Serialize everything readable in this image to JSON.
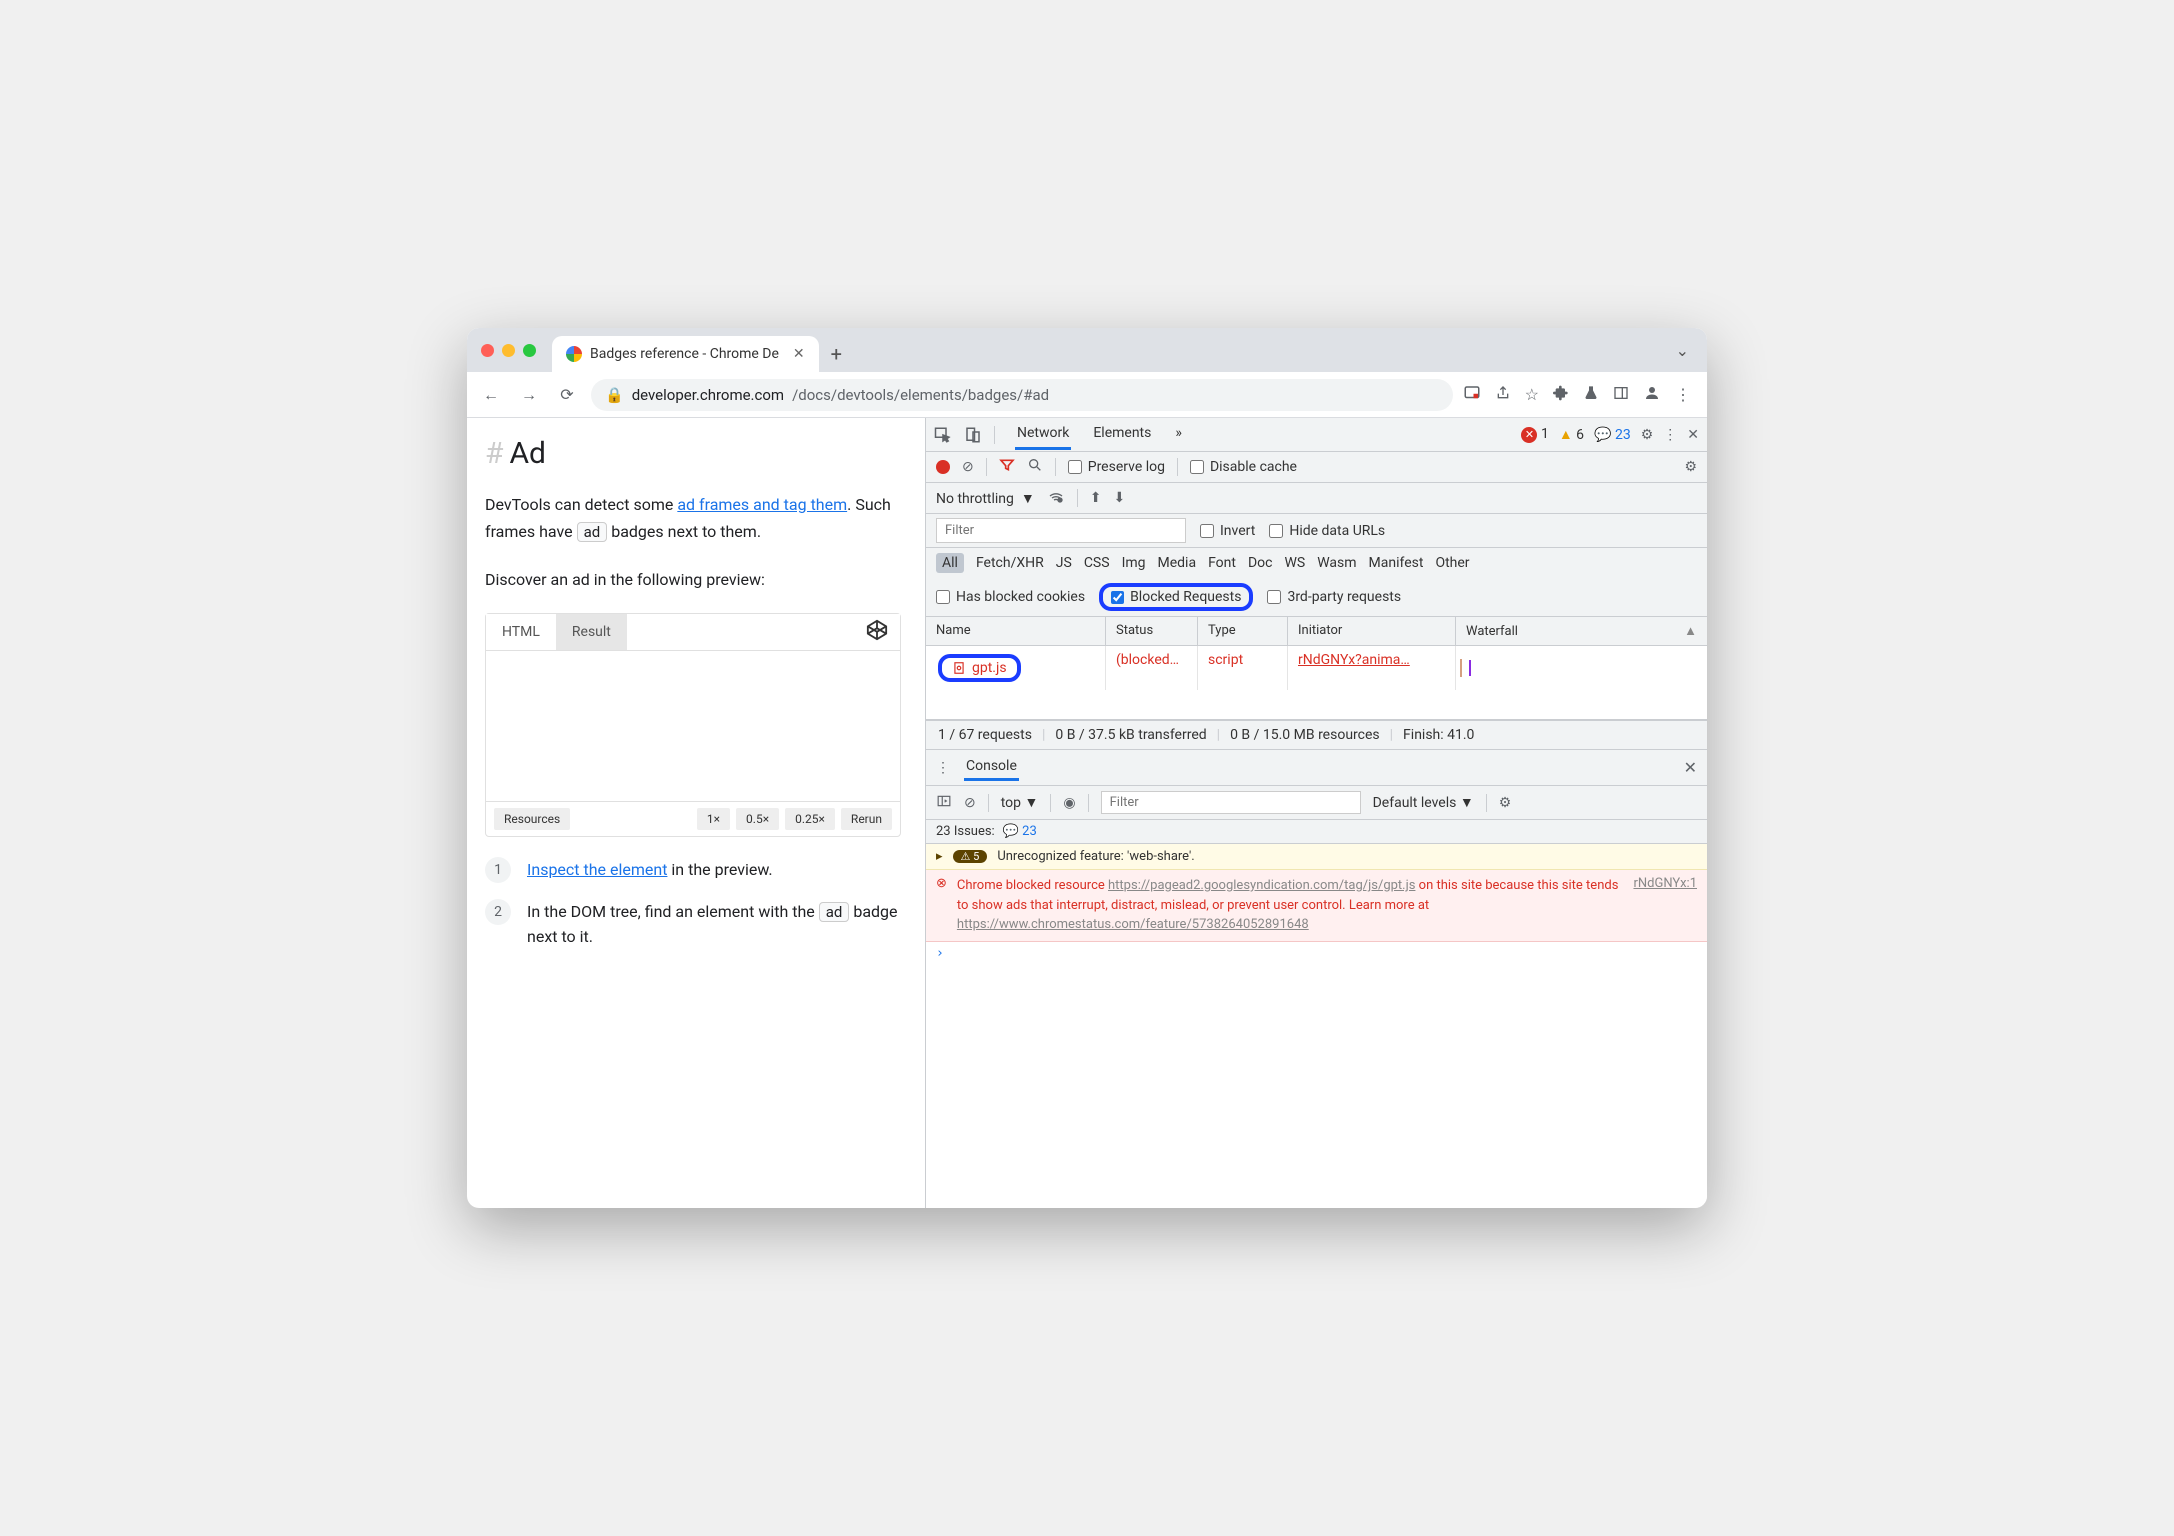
{
  "titlebar": {
    "tab_title": "Badges reference - Chrome De"
  },
  "addressbar": {
    "host": "developer.chrome.com",
    "path": "/docs/devtools/elements/badges/#ad"
  },
  "content": {
    "heading": "Ad",
    "p1_part1": "DevTools can detect some ",
    "p1_link": "ad frames and tag them",
    "p1_part2": ". Such frames have ",
    "p1_badge": "ad",
    "p1_part3": " badges next to them.",
    "p2": "Discover an ad in the following preview:",
    "codepen": {
      "tab_html": "HTML",
      "tab_result": "Result",
      "resources": "Resources",
      "z1": "1×",
      "z05": "0.5×",
      "z025": "0.25×",
      "rerun": "Rerun"
    },
    "step1_link": "Inspect the element",
    "step1_rest": " in the preview.",
    "step2_part1": "In the DOM tree, find an element with the ",
    "step2_badge": "ad",
    "step2_part2": " badge next to it."
  },
  "devtools": {
    "tabs": {
      "network": "Network",
      "elements": "Elements"
    },
    "status": {
      "errors": "1",
      "warnings": "6",
      "messages": "23"
    },
    "net": {
      "preserve": "Preserve log",
      "disable_cache": "Disable cache",
      "throttle": "No throttling",
      "filter_placeholder": "Filter",
      "invert": "Invert",
      "hide_urls": "Hide data URLs",
      "types": [
        "All",
        "Fetch/XHR",
        "JS",
        "CSS",
        "Img",
        "Media",
        "Font",
        "Doc",
        "WS",
        "Wasm",
        "Manifest",
        "Other"
      ],
      "has_blocked": "Has blocked cookies",
      "blocked_req": "Blocked Requests",
      "third_party": "3rd-party requests",
      "cols": {
        "name": "Name",
        "status": "Status",
        "type": "Type",
        "initiator": "Initiator",
        "waterfall": "Waterfall"
      },
      "row": {
        "name": "gpt.js",
        "status": "(blocked…",
        "type": "script",
        "initiator": "rNdGNYx?anima…"
      },
      "summary": {
        "requests": "1 / 67 requests",
        "transferred": "0 B / 37.5 kB transferred",
        "resources": "0 B / 15.0 MB resources",
        "finish": "Finish: 41.0"
      }
    },
    "console": {
      "label": "Console",
      "context": "top",
      "filter_placeholder": "Filter",
      "levels": "Default levels",
      "issues_label": "23 Issues:",
      "issues_count": "23",
      "warn_count": "5",
      "warn_text": "Unrecognized feature: 'web-share'.",
      "err_pre": "Chrome blocked resource ",
      "err_url1": "https://pagead2.googlesyndication.com/tag/js/gpt.js",
      "err_mid": " on this site because this site tends to show ads that interrupt, distract, mislead, or prevent user control. Learn more at ",
      "err_url2": "https://www.chromestatus.com/feature/5738264052891648",
      "err_source": "rNdGNYx:1"
    }
  }
}
